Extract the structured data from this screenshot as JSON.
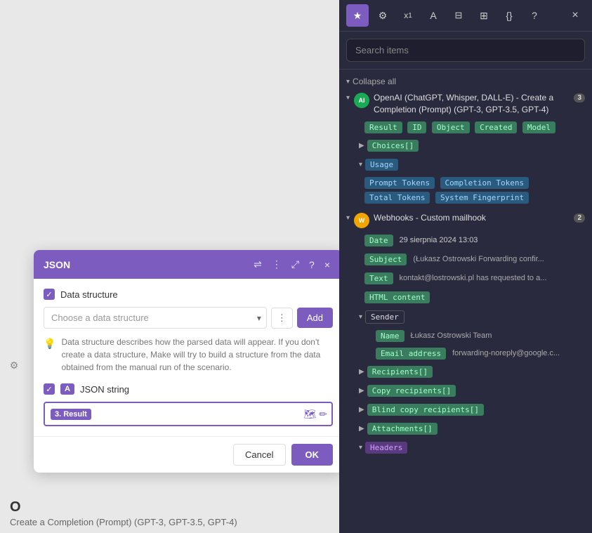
{
  "colors": {
    "bg": "#e8e8e8",
    "panelBg": "#2a2a3e",
    "accent": "#7c5cbf",
    "tagGreen": "#3a7d5e",
    "tagBlue": "#2a5a7e"
  },
  "jsonPanel": {
    "title": "JSON",
    "dataStructureLabel": "Data structure",
    "choosePlaceholder": "Choose a data structure",
    "addLabel": "Add",
    "helpText": "Data structure describes how the parsed data will appear. If you don't create a data structure, Make will try to build a structure from the data obtained from the manual run of the scenario.",
    "jsonStringLabel": "JSON string",
    "tokenBadge": "3. Result",
    "cancelLabel": "Cancel",
    "okLabel": "OK"
  },
  "bottomBar": {
    "number": "O",
    "description": "Create a Completion (Prompt) (GPT-3, GPT-3.5, GPT-4)"
  },
  "rightPanel": {
    "toolbar": {
      "starIcon": "★",
      "gearIcon": "⚙",
      "superscriptIcon": "x¹",
      "textIcon": "A",
      "calendarIcon": "📅",
      "tableIcon": "⊞",
      "braceIcon": "{}",
      "helpIcon": "?",
      "closeIcon": "×"
    },
    "searchPlaceholder": "Search items",
    "collapseAll": "Collapse all",
    "modules": [
      {
        "id": "openai",
        "iconType": "openai",
        "iconText": "AI",
        "badge": "3",
        "title": "OpenAI (ChatGPT, Whisper, DALL-E) - Create a Completion (Prompt) (GPT-3, GPT-3.5, GPT-4)",
        "expanded": true,
        "tags": [
          "Result",
          "ID",
          "Object",
          "Created",
          "Model"
        ],
        "choices": {
          "label": "Choices[]",
          "collapsed": true
        },
        "usage": {
          "label": "Usage",
          "expanded": true,
          "tags": [
            "Prompt Tokens",
            "Completion Tokens",
            "Total Tokens",
            "System Fingerprint"
          ]
        }
      },
      {
        "id": "webhooks",
        "iconType": "webhook",
        "iconText": "W",
        "badge": "2",
        "title": "Webhooks - Custom mailhook",
        "expanded": true,
        "fields": [
          {
            "key": "Date",
            "value": "29 sierpnia 2024 13:03"
          },
          {
            "key": "Subject",
            "value": "(Łukasz Ostrowski Forwarding confir..."
          },
          {
            "key": "Text",
            "value": "kontakt@lostrowski.pl has requested to a..."
          },
          {
            "key": "HTML content",
            "value": ""
          }
        ],
        "sender": {
          "label": "Sender",
          "expanded": true,
          "fields": [
            {
              "key": "Name",
              "value": "Łukasz Ostrowski Team"
            },
            {
              "key": "Email address",
              "value": "forwarding-noreply@google.c..."
            }
          ]
        },
        "collapsedTags": [
          "Recipients[]",
          "Copy recipients[]",
          "Blind copy recipients[]",
          "Attachments[]"
        ],
        "headers": {
          "label": "Headers",
          "expanded": true
        }
      }
    ]
  }
}
